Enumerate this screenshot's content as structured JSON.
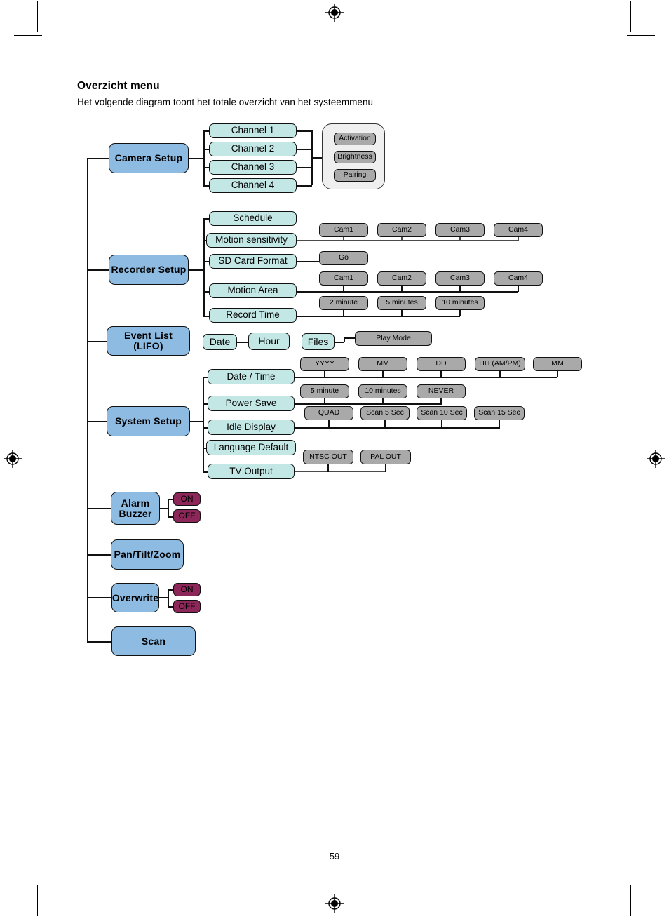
{
  "document": {
    "heading": "Overzicht menu",
    "subheading": "Het volgende diagram toont het totale overzicht van het systeemmenu",
    "page_number": "59"
  },
  "diagram": {
    "level1": [
      {
        "id": "camera-setup",
        "label": "Camera Setup"
      },
      {
        "id": "recorder-setup",
        "label": "Recorder Setup"
      },
      {
        "id": "event-list",
        "label": "Event List\n(LIFO)"
      },
      {
        "id": "system-setup",
        "label": "System Setup"
      },
      {
        "id": "alarm-buzzer",
        "label": "Alarm\nBuzzer"
      },
      {
        "id": "pan-tilt-zoom",
        "label": "Pan/Tilt/Zoom"
      },
      {
        "id": "overwrite",
        "label": "Overwrite"
      },
      {
        "id": "scan",
        "label": "Scan"
      }
    ],
    "camera_setup": {
      "channels": [
        {
          "label": "Channel 1"
        },
        {
          "label": "Channel 2"
        },
        {
          "label": "Channel 3"
        },
        {
          "label": "Channel 4"
        }
      ],
      "options": [
        {
          "label": "Activation"
        },
        {
          "label": "Brightness"
        },
        {
          "label": "Pairing"
        }
      ]
    },
    "recorder_setup": {
      "items": [
        {
          "label": "Schedule",
          "values": []
        },
        {
          "label": "Motion sensitivity",
          "values": [
            "Cam1",
            "Cam2",
            "Cam3",
            "Cam4"
          ]
        },
        {
          "label": "SD Card Format",
          "values": [
            "Go"
          ]
        },
        {
          "label": "Motion Area",
          "values": [
            "Cam1",
            "Cam2",
            "Cam3",
            "Cam4"
          ]
        },
        {
          "label": "Record Time",
          "values": [
            "2 minute",
            "5 minutes",
            "10 minutes"
          ]
        }
      ]
    },
    "event_list": {
      "date": "Date",
      "hour": "Hour",
      "files": "Files",
      "play_mode": "Play Mode"
    },
    "system_setup": {
      "items": [
        {
          "label": "Date / Time",
          "values": [
            "YYYY",
            "MM",
            "DD",
            "HH (AM/PM)",
            "MM"
          ]
        },
        {
          "label": "Power Save",
          "values": [
            "5 minute",
            "10 minutes",
            "NEVER"
          ]
        },
        {
          "label": "Idle Display",
          "values": [
            "QUAD",
            "Scan 5 Sec",
            "Scan 10 Sec",
            "Scan 15 Sec"
          ]
        },
        {
          "label": "Language Default",
          "values": []
        },
        {
          "label": "TV Output",
          "values": [
            "NTSC OUT",
            "PAL OUT"
          ]
        }
      ]
    },
    "alarm_buzzer": {
      "on": "ON",
      "off": "OFF"
    },
    "overwrite": {
      "on": "ON",
      "off": "OFF"
    },
    "colors": {
      "primary_node": "#8dbbe2",
      "sub_node": "#c3e7e5",
      "value_node": "#a9a9a9",
      "toggle_node": "#8d2659",
      "panel": "#efefef",
      "line": "#111111"
    }
  }
}
